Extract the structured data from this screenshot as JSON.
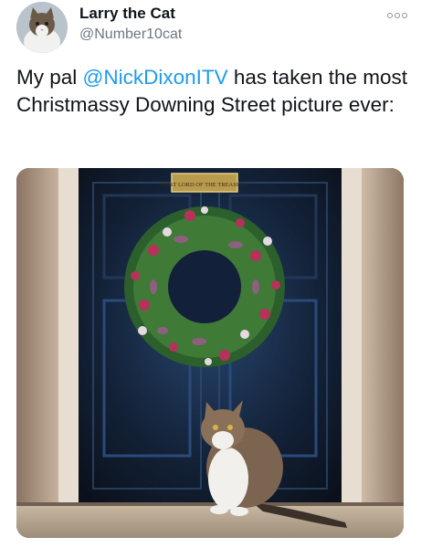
{
  "author": {
    "name": "Larry the Cat",
    "handle": "@Number10cat"
  },
  "tweet": {
    "prefix": "My pal ",
    "mention": "@NickDixonITV",
    "suffix": " has taken the most Christmassy Downing Street picture ever:"
  },
  "photo": {
    "plaque_text": "FIRST LORD OF THE TREASURY"
  },
  "colors": {
    "link": "#1d9bf0",
    "secondary_text": "#6e7780",
    "door": "#111a2a"
  },
  "icons": [
    "more-icon"
  ]
}
